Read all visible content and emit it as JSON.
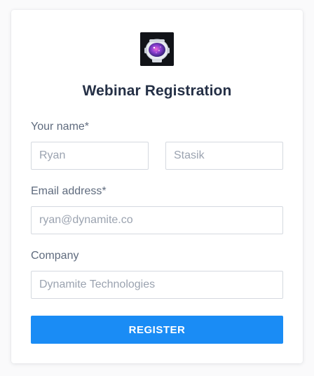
{
  "logo": {
    "icon": "astronaut-helmet-icon"
  },
  "form": {
    "title": "Webinar Registration",
    "name_label": "Your name*",
    "first_name_placeholder": "Ryan",
    "last_name_placeholder": "Stasik",
    "email_label": "Email address*",
    "email_placeholder": "ryan@dynamite.co",
    "company_label": "Company",
    "company_placeholder": "Dynamite Technologies",
    "submit_label": "REGISTER"
  },
  "colors": {
    "accent": "#1a8cf5",
    "title": "#253046",
    "label": "#5f6b7e",
    "placeholder": "#9ba3b0",
    "border": "#d5d9e0"
  }
}
